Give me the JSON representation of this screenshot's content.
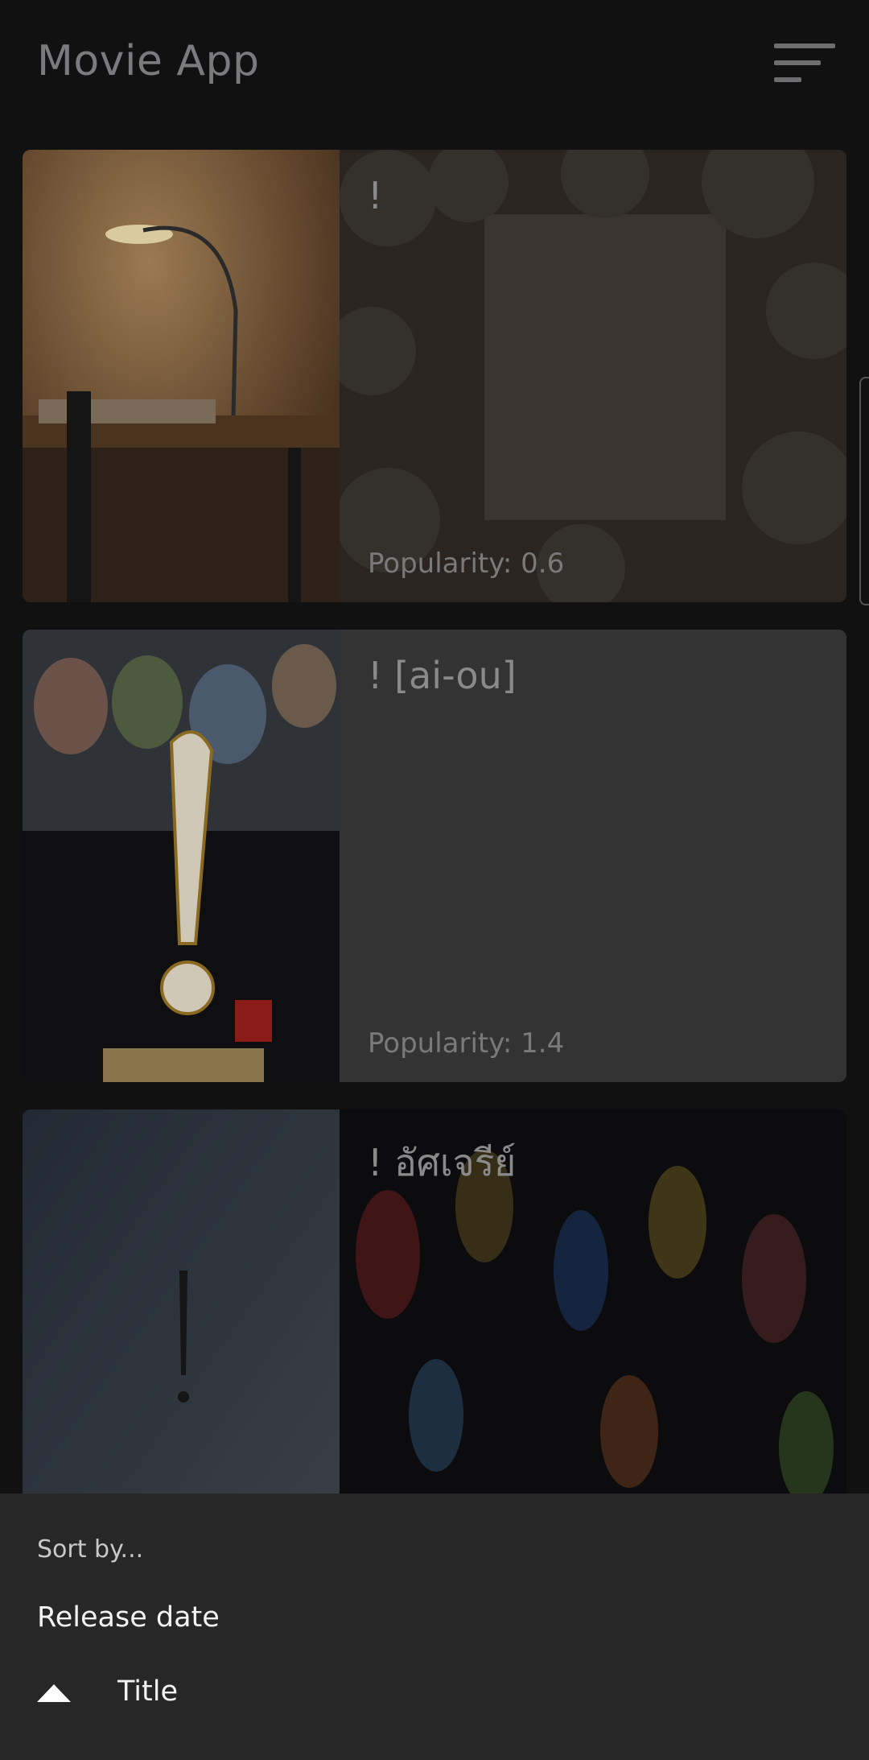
{
  "app": {
    "title": "Movie App"
  },
  "toolbar": {
    "sort_icon": "sort-icon"
  },
  "movies": [
    {
      "title": "!",
      "popularity": "Popularity: 0.6"
    },
    {
      "title": "! [ai-ou]",
      "popularity": "Popularity: 1.4"
    },
    {
      "title": "! อัศเจรีย์",
      "popularity": ""
    }
  ],
  "sort_sheet": {
    "header": "Sort by...",
    "options": [
      {
        "label": "Release date",
        "icon": ""
      },
      {
        "label": "Title",
        "icon": "ascending-arrow-icon"
      }
    ]
  }
}
